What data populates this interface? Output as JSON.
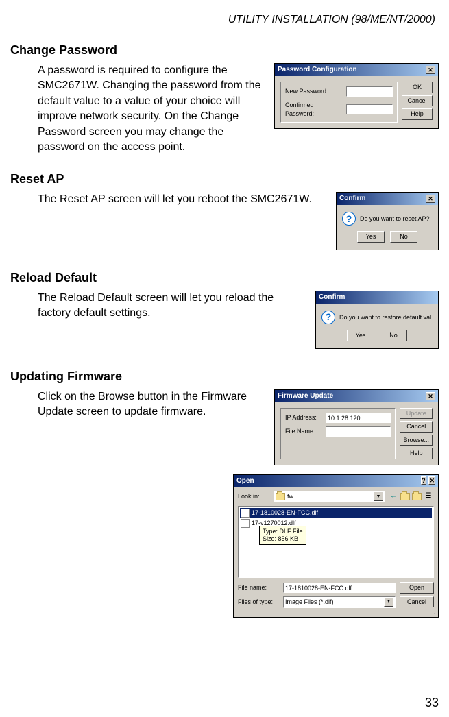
{
  "header": "UTILITY INSTALLATION (98/ME/NT/2000)",
  "page_number": "33",
  "sections": {
    "change_password": {
      "title": "Change Password",
      "body": "A password is required to configure the SMC2671W. Changing the password from the default value to a value of your choice will improve network security. On the Change Password screen you may change the password on the access point."
    },
    "reset_ap": {
      "title": "Reset AP",
      "body": "The Reset AP screen will let you reboot the SMC2671W."
    },
    "reload_default": {
      "title": "Reload Default",
      "body": "The Reload Default screen will let you reload the factory default settings."
    },
    "updating_firmware": {
      "title": "Updating Firmware",
      "body": "Click on the Browse button in the Firmware Update screen to update firmware."
    }
  },
  "dialogs": {
    "password": {
      "title": "Password Configuration",
      "new_password_label": "New Password:",
      "confirmed_password_label": "Confirmed Password:",
      "ok": "OK",
      "cancel": "Cancel",
      "help": "Help"
    },
    "confirm_reset": {
      "title": "Confirm",
      "message": "Do you want to reset AP?",
      "yes": "Yes",
      "no": "No"
    },
    "confirm_reload": {
      "title": "Confirm",
      "message": "Do you want to restore default val",
      "yes": "Yes",
      "no": "No"
    },
    "firmware": {
      "title": "Firmware Update",
      "ip_label": "IP Address:",
      "ip_value": "10.1.28.120",
      "file_label": "File Name:",
      "update": "Update",
      "cancel": "Cancel",
      "browse": "Browse...",
      "help": "Help"
    },
    "open": {
      "title": "Open",
      "look_in": "Look in:",
      "folder": "fw",
      "files": {
        "f1": "17-1810028-EN-FCC.dlf",
        "f2": "17-v1270012.dlf"
      },
      "tooltip_type": "Type: DLF File",
      "tooltip_size": "Size: 856 KB",
      "file_name_label": "File name:",
      "file_name_value": "17-1810028-EN-FCC.dlf",
      "files_of_type_label": "Files of type:",
      "files_of_type_value": "Image Files (*.dlf)",
      "open_btn": "Open",
      "cancel_btn": "Cancel",
      "nav_back": "←",
      "dropdown_arrow": "▼",
      "close_glyph": "✕",
      "help_glyph": "?"
    }
  }
}
